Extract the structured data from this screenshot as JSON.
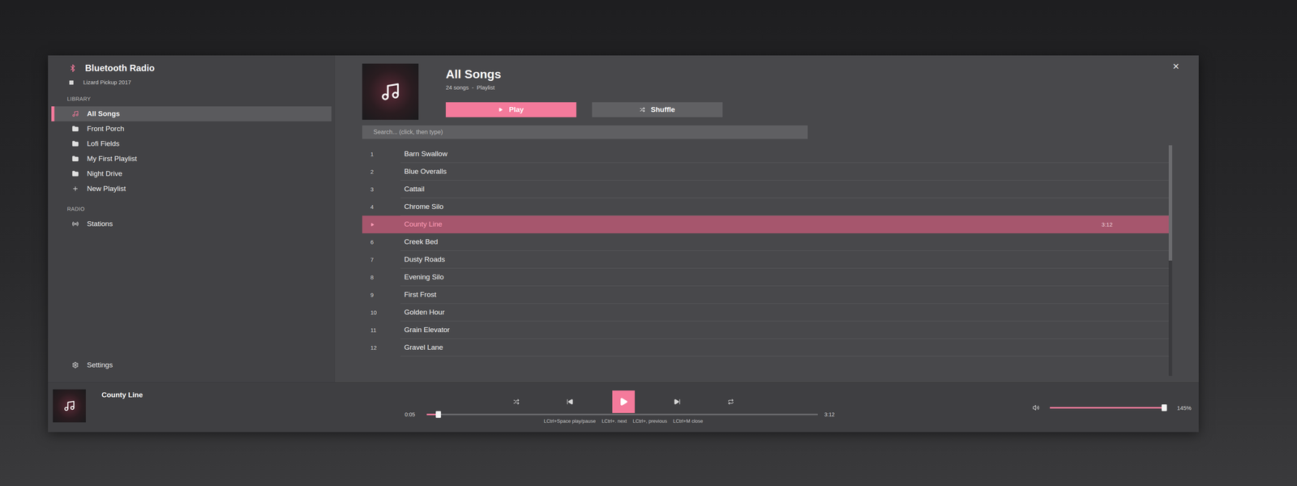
{
  "app": {
    "title": "Bluetooth Radio",
    "device": "Lizard Pickup 2017",
    "close": "×"
  },
  "sidebar": {
    "sections": [
      {
        "label": "LIBRARY",
        "items": [
          {
            "label": "All Songs",
            "kind": "library",
            "selected": true
          },
          {
            "label": "Front Porch",
            "kind": "playlist",
            "selected": false
          },
          {
            "label": "Lofi Fields",
            "kind": "playlist",
            "selected": false
          },
          {
            "label": "My First Playlist",
            "kind": "playlist",
            "selected": false
          },
          {
            "label": "Night Drive",
            "kind": "playlist",
            "selected": false
          },
          {
            "label": "New Playlist",
            "kind": "new",
            "selected": false
          }
        ]
      },
      {
        "label": "RADIO",
        "items": [
          {
            "label": "Stations",
            "kind": "radio",
            "selected": false
          }
        ]
      }
    ],
    "settings": {
      "label": "Settings"
    }
  },
  "playlist": {
    "title": "All Songs",
    "meta": "24 songs  -  Playlist",
    "play": "Play",
    "shuffle": "Shuffle",
    "search_placeholder": "Search... (click, then type)",
    "scroll_level": 0.5,
    "tracks": [
      {
        "number": "1",
        "title": "Barn Swallow",
        "selected": false,
        "playing": false
      },
      {
        "number": "2",
        "title": "Blue Overalls",
        "selected": false,
        "playing": false
      },
      {
        "number": "3",
        "title": "Cattail",
        "selected": false,
        "playing": false
      },
      {
        "number": "4",
        "title": "Chrome Silo",
        "selected": false,
        "playing": false
      },
      {
        "title": "County Line",
        "selected": true,
        "playing": true,
        "duration": "3:12"
      },
      {
        "number": "6",
        "title": "Creek Bed",
        "selected": false,
        "playing": false
      },
      {
        "number": "7",
        "title": "Dusty Roads",
        "selected": false,
        "playing": false
      },
      {
        "number": "8",
        "title": "Evening Silo",
        "selected": false,
        "playing": false
      },
      {
        "number": "9",
        "title": "First Frost",
        "selected": false,
        "playing": false
      },
      {
        "number": "10",
        "title": "Golden Hour",
        "selected": false,
        "playing": false
      },
      {
        "number": "11",
        "title": "Grain Elevator",
        "selected": false,
        "playing": false
      },
      {
        "number": "12",
        "title": "Gravel Lane",
        "selected": false,
        "playing": false
      }
    ]
  },
  "player": {
    "title": "County Line",
    "elapsed": "0:05",
    "total": "3:12",
    "progress": 0.03,
    "playing": false,
    "shuffle": false,
    "repeat": false,
    "hints": [
      {
        "keys": "LCtrl+Space",
        "action": "play/pause"
      },
      {
        "keys": "LCtrl+.",
        "action": "next"
      },
      {
        "keys": "LCtrl+,",
        "action": "previous"
      },
      {
        "keys": "LCtrl+M",
        "action": "close"
      }
    ],
    "volume": {
      "level": 0.98,
      "reading": "145%"
    }
  }
}
